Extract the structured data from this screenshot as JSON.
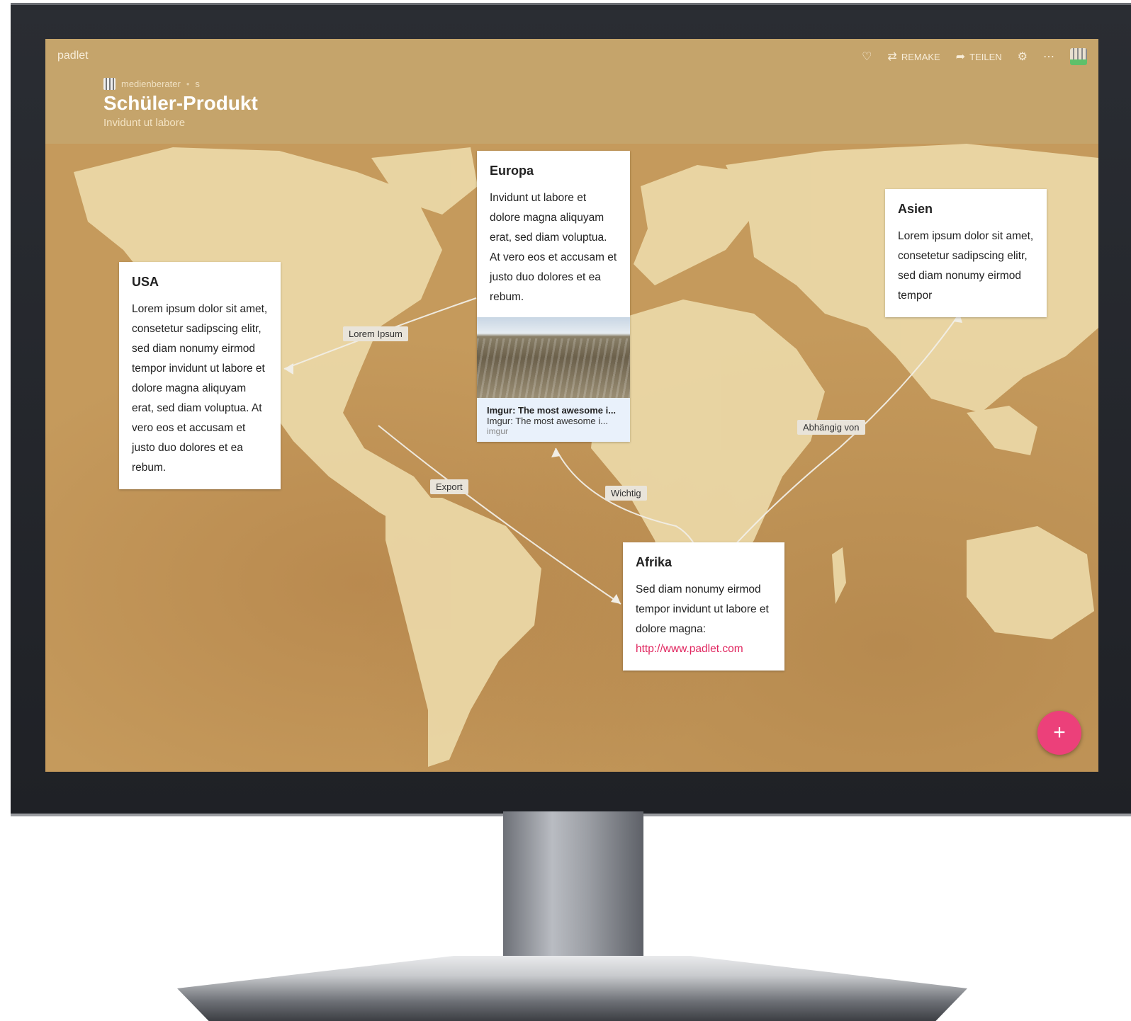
{
  "app": {
    "brand": "padlet"
  },
  "toolbar": {
    "heart_icon": "heart-icon",
    "remake_label": "REMAKE",
    "share_label": "TEILEN",
    "settings_icon": "gear-icon",
    "more_icon": "more-icon"
  },
  "board": {
    "author": "medienberater",
    "author_suffix": "s",
    "title": "Schüler-Produkt",
    "subtitle": "Invidunt ut labore"
  },
  "cards": {
    "usa": {
      "title": "USA",
      "body": "Lorem ipsum dolor sit amet, consetetur sadipscing elitr, sed diam nonumy eirmod tempor invidunt ut labore et dolore magna aliquyam erat, sed diam voluptua. At vero eos et accusam et justo duo dolores et ea rebum."
    },
    "europa": {
      "title": "Europa",
      "body": "Invidunt ut labore et dolore magna aliquyam erat, sed diam voluptua. At vero eos et accusam et justo duo dolores et ea rebum.",
      "link_title": "Imgur: The most awesome i...",
      "link_desc": "Imgur: The most awesome i...",
      "link_source": "imgur"
    },
    "asien": {
      "title": "Asien",
      "body": "Lorem ipsum dolor sit amet, consetetur sadipscing elitr, sed diam nonumy eirmod tempor"
    },
    "afrika": {
      "title": "Afrika",
      "body": "Sed diam nonumy eirmod tempor invidunt ut labore et dolore magna:",
      "link": "http://www.padlet.com"
    }
  },
  "connections": {
    "lorem_ipsum": "Lorem Ipsum",
    "export": "Export",
    "wichtig": "Wichtig",
    "abhaengig": "Abhängig von"
  },
  "fab": {
    "label": "+"
  },
  "colors": {
    "header": "#c5a46b",
    "fab": "#ec407a",
    "link": "#e0245e"
  }
}
